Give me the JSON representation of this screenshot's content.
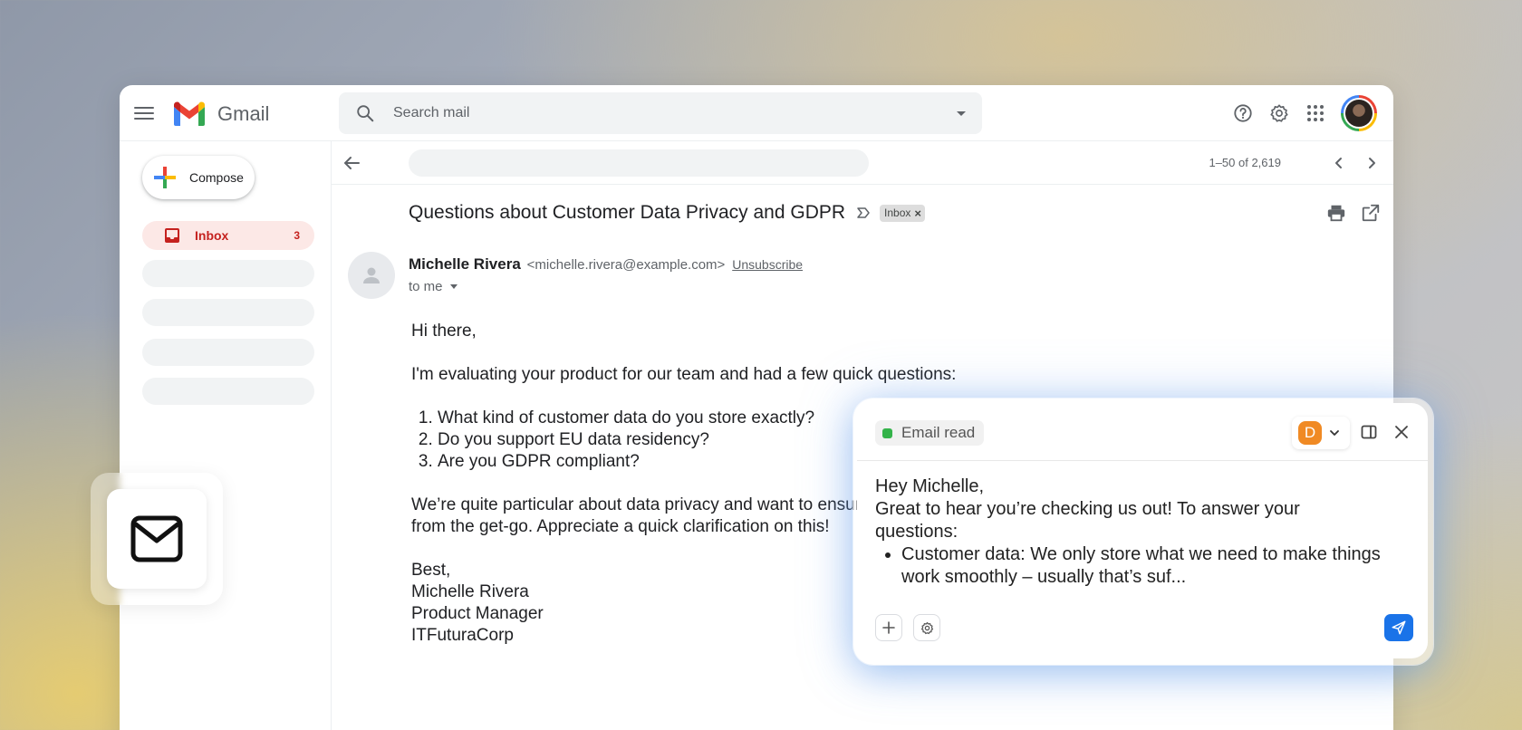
{
  "app": {
    "name": "Gmail",
    "search_placeholder": "Search mail"
  },
  "sidebar": {
    "compose_label": "Compose",
    "inbox_label": "Inbox",
    "inbox_count": "3"
  },
  "toolbar": {
    "pager_text": "1–50 of 2,619"
  },
  "email": {
    "subject": "Questions about Customer Data Privacy and GDPR",
    "label_chip": "Inbox",
    "label_chip_close": "×",
    "sender_name": "Michelle Rivera",
    "sender_email": "<michelle.rivera@example.com>",
    "unsubscribe": "Unsubscribe",
    "to_line": "to me",
    "greeting": "Hi there,",
    "intro": "I'm evaluating your product for our team and had a few quick questions:",
    "questions": [
      "What kind of customer data do you store exactly?",
      "Do you support EU data residency?",
      "Are you GDPR compliant?"
    ],
    "para_line1": "We’re quite particular about data privacy and want to ensure everything is aligned",
    "para_line2": "from the get-go. Appreciate a quick clarification on this!",
    "signoff": "Best,",
    "sig_name": "Michelle Rivera",
    "sig_title": "Product Manager",
    "sig_company": "ITFuturaCorp"
  },
  "assistant": {
    "status": "Email read",
    "status_color": "#34b34a",
    "account_initial": "D",
    "account_color": "#f08a24",
    "reply_line1": "Hey Michelle,",
    "reply_line2": "Great to hear you’re checking us out! To answer your questions:",
    "reply_bullet1": "Customer data: We only store what we need to make things work smoothly – usually that’s suf..."
  },
  "icons": {
    "menu": "hamburger-icon",
    "search": "search-icon",
    "help": "help-icon",
    "settings": "gear-icon",
    "apps": "apps-grid-icon",
    "back": "arrow-back-icon",
    "print": "print-icon",
    "open_new": "open-in-new-icon",
    "mail": "envelope-icon",
    "send": "send-icon"
  }
}
